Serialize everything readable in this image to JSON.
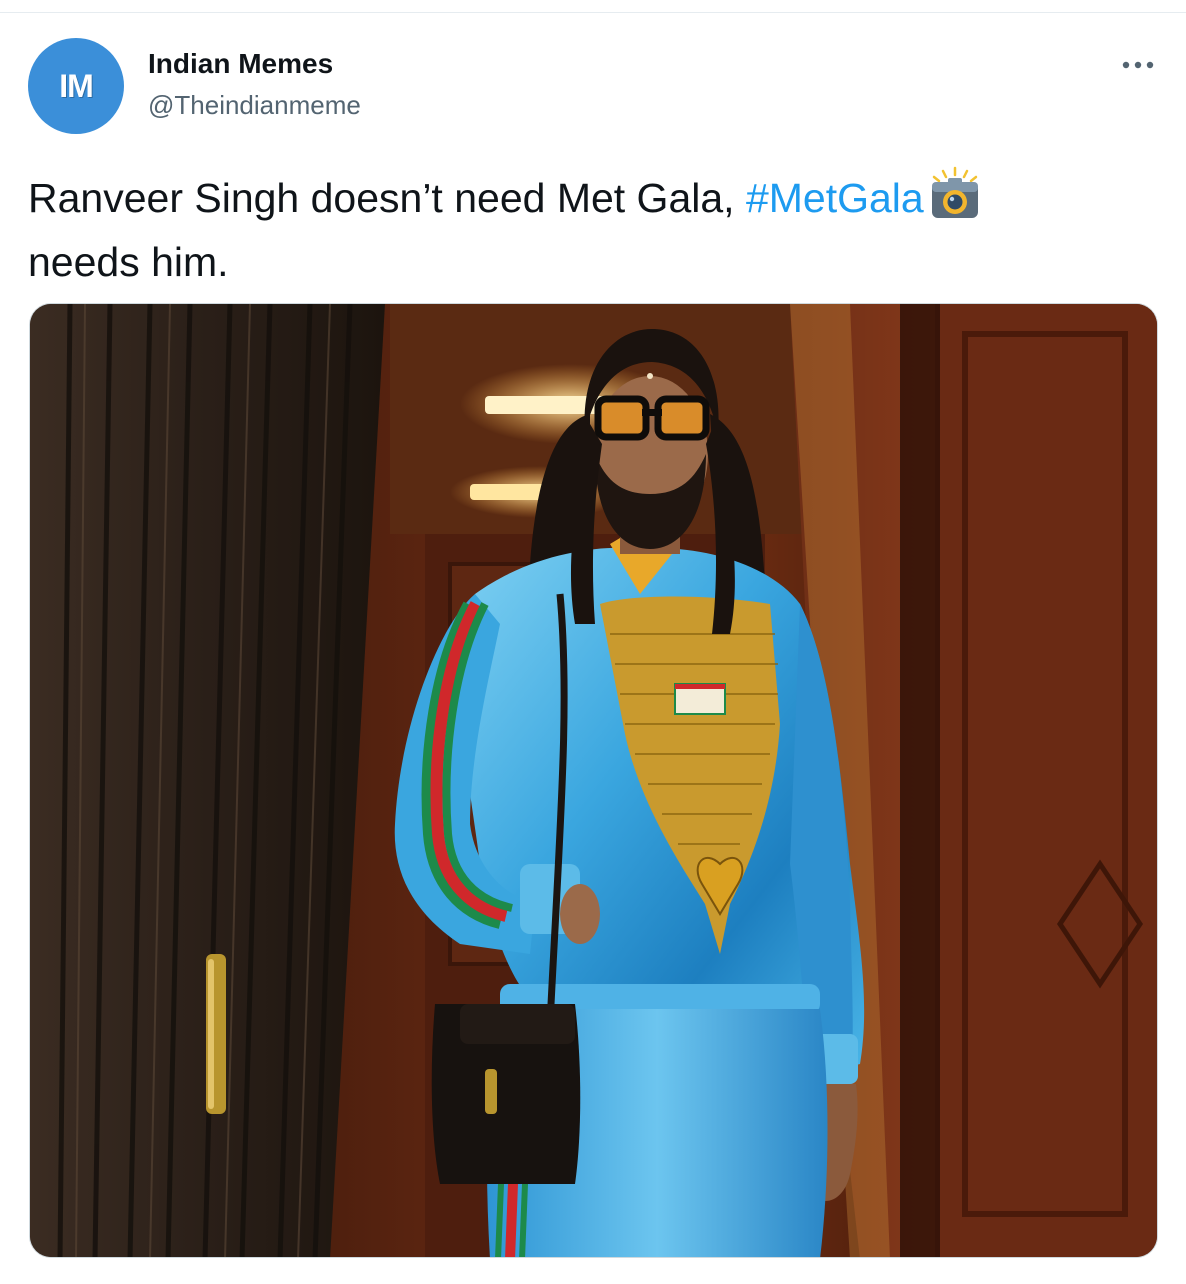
{
  "tweet": {
    "author": {
      "avatar_initials": "IM",
      "display_name": "Indian Memes",
      "handle": "@Theindianmeme"
    },
    "more_icon": "more-horizontal-icon",
    "text": {
      "part1": "Ranveer Singh doesn’t need Met Gala, ",
      "hashtag": "#MetGala",
      "emoji": "camera-flash-emoji",
      "part2": "needs him."
    },
    "media": {
      "kind": "photo"
    }
  },
  "colors": {
    "accent": "#1d9bf0",
    "avatar_bg": "#3b8fd9",
    "secondary_text": "#536471",
    "primary_text": "#0f1419"
  }
}
